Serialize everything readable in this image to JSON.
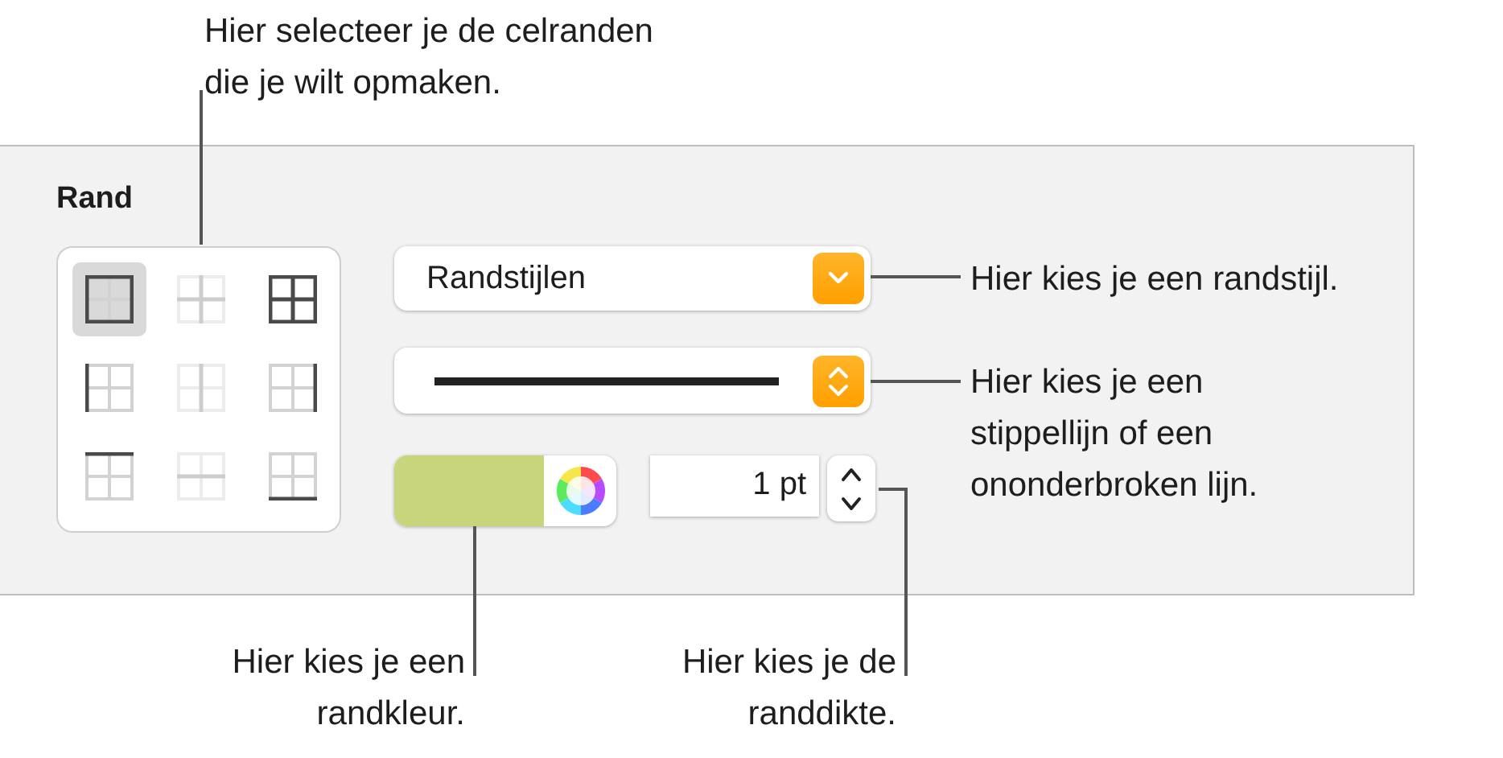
{
  "panel": {
    "title": "Rand",
    "border_options": [
      {
        "kind": "outer",
        "selected": true,
        "disabled": false
      },
      {
        "kind": "inner",
        "selected": false,
        "disabled": true
      },
      {
        "kind": "all",
        "selected": false,
        "disabled": false
      },
      {
        "kind": "left",
        "selected": false,
        "disabled": false
      },
      {
        "kind": "vertical",
        "selected": false,
        "disabled": true
      },
      {
        "kind": "right",
        "selected": false,
        "disabled": false
      },
      {
        "kind": "top",
        "selected": false,
        "disabled": false
      },
      {
        "kind": "horizontal",
        "selected": false,
        "disabled": true
      },
      {
        "kind": "bottom",
        "selected": false,
        "disabled": false
      }
    ],
    "style_menu": {
      "value": "Randstijlen"
    },
    "line_menu": {
      "kind": "solid"
    },
    "color_well": {
      "color": "#c8d57a"
    },
    "width_field": {
      "value": "1 pt"
    }
  },
  "callouts": [
    {
      "text": "Hier selecteer je de celranden\ndie je wilt opmaken."
    },
    {
      "text": "Hier kies je een randstijl."
    },
    {
      "text": "Hier kies je een\nstippellijn of een\nononderbroken lijn."
    },
    {
      "text": "Hier kies je een\nrandkleur."
    },
    {
      "text": "Hier kies je de\nranddikte."
    }
  ]
}
